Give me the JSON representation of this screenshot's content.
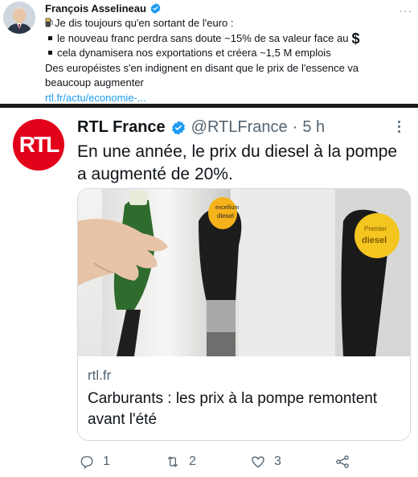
{
  "top_tweet": {
    "author": "François Asselineau",
    "lines": [
      "Je dis toujours qu'en sortant de l'euro :",
      "le nouveau franc perdra sans doute ~15% de sa valeur face au",
      "cela dynamisera nos exportations et créera ~1,5 M emplois",
      "Des européistes s'en indignent en disant que le prix de l'essence va",
      "beaucoup augmenter"
    ],
    "dollar_sign": "$",
    "link": "rtl.fr/actu/economie-..."
  },
  "embed": {
    "name": "RTL France",
    "handle": "@RTLFrance",
    "dot": "·",
    "time": "5 h",
    "logo_text": "RTL",
    "text": "En une année, le prix du diesel à la pompe a augmenté de 20%.",
    "card": {
      "domain": "rtl.fr",
      "title": "Carburants : les prix à la pompe remontent avant l'été",
      "nozzle_labels": [
        "excellium",
        "diesel",
        "Premier",
        "diesel"
      ]
    },
    "actions": {
      "reply_count": "1",
      "retweet_count": "2",
      "like_count": "3"
    }
  },
  "colors": {
    "verified": "#1d9bf0",
    "rtl_red": "#e2001a",
    "link": "#1d9bf0",
    "muted": "#536471"
  }
}
